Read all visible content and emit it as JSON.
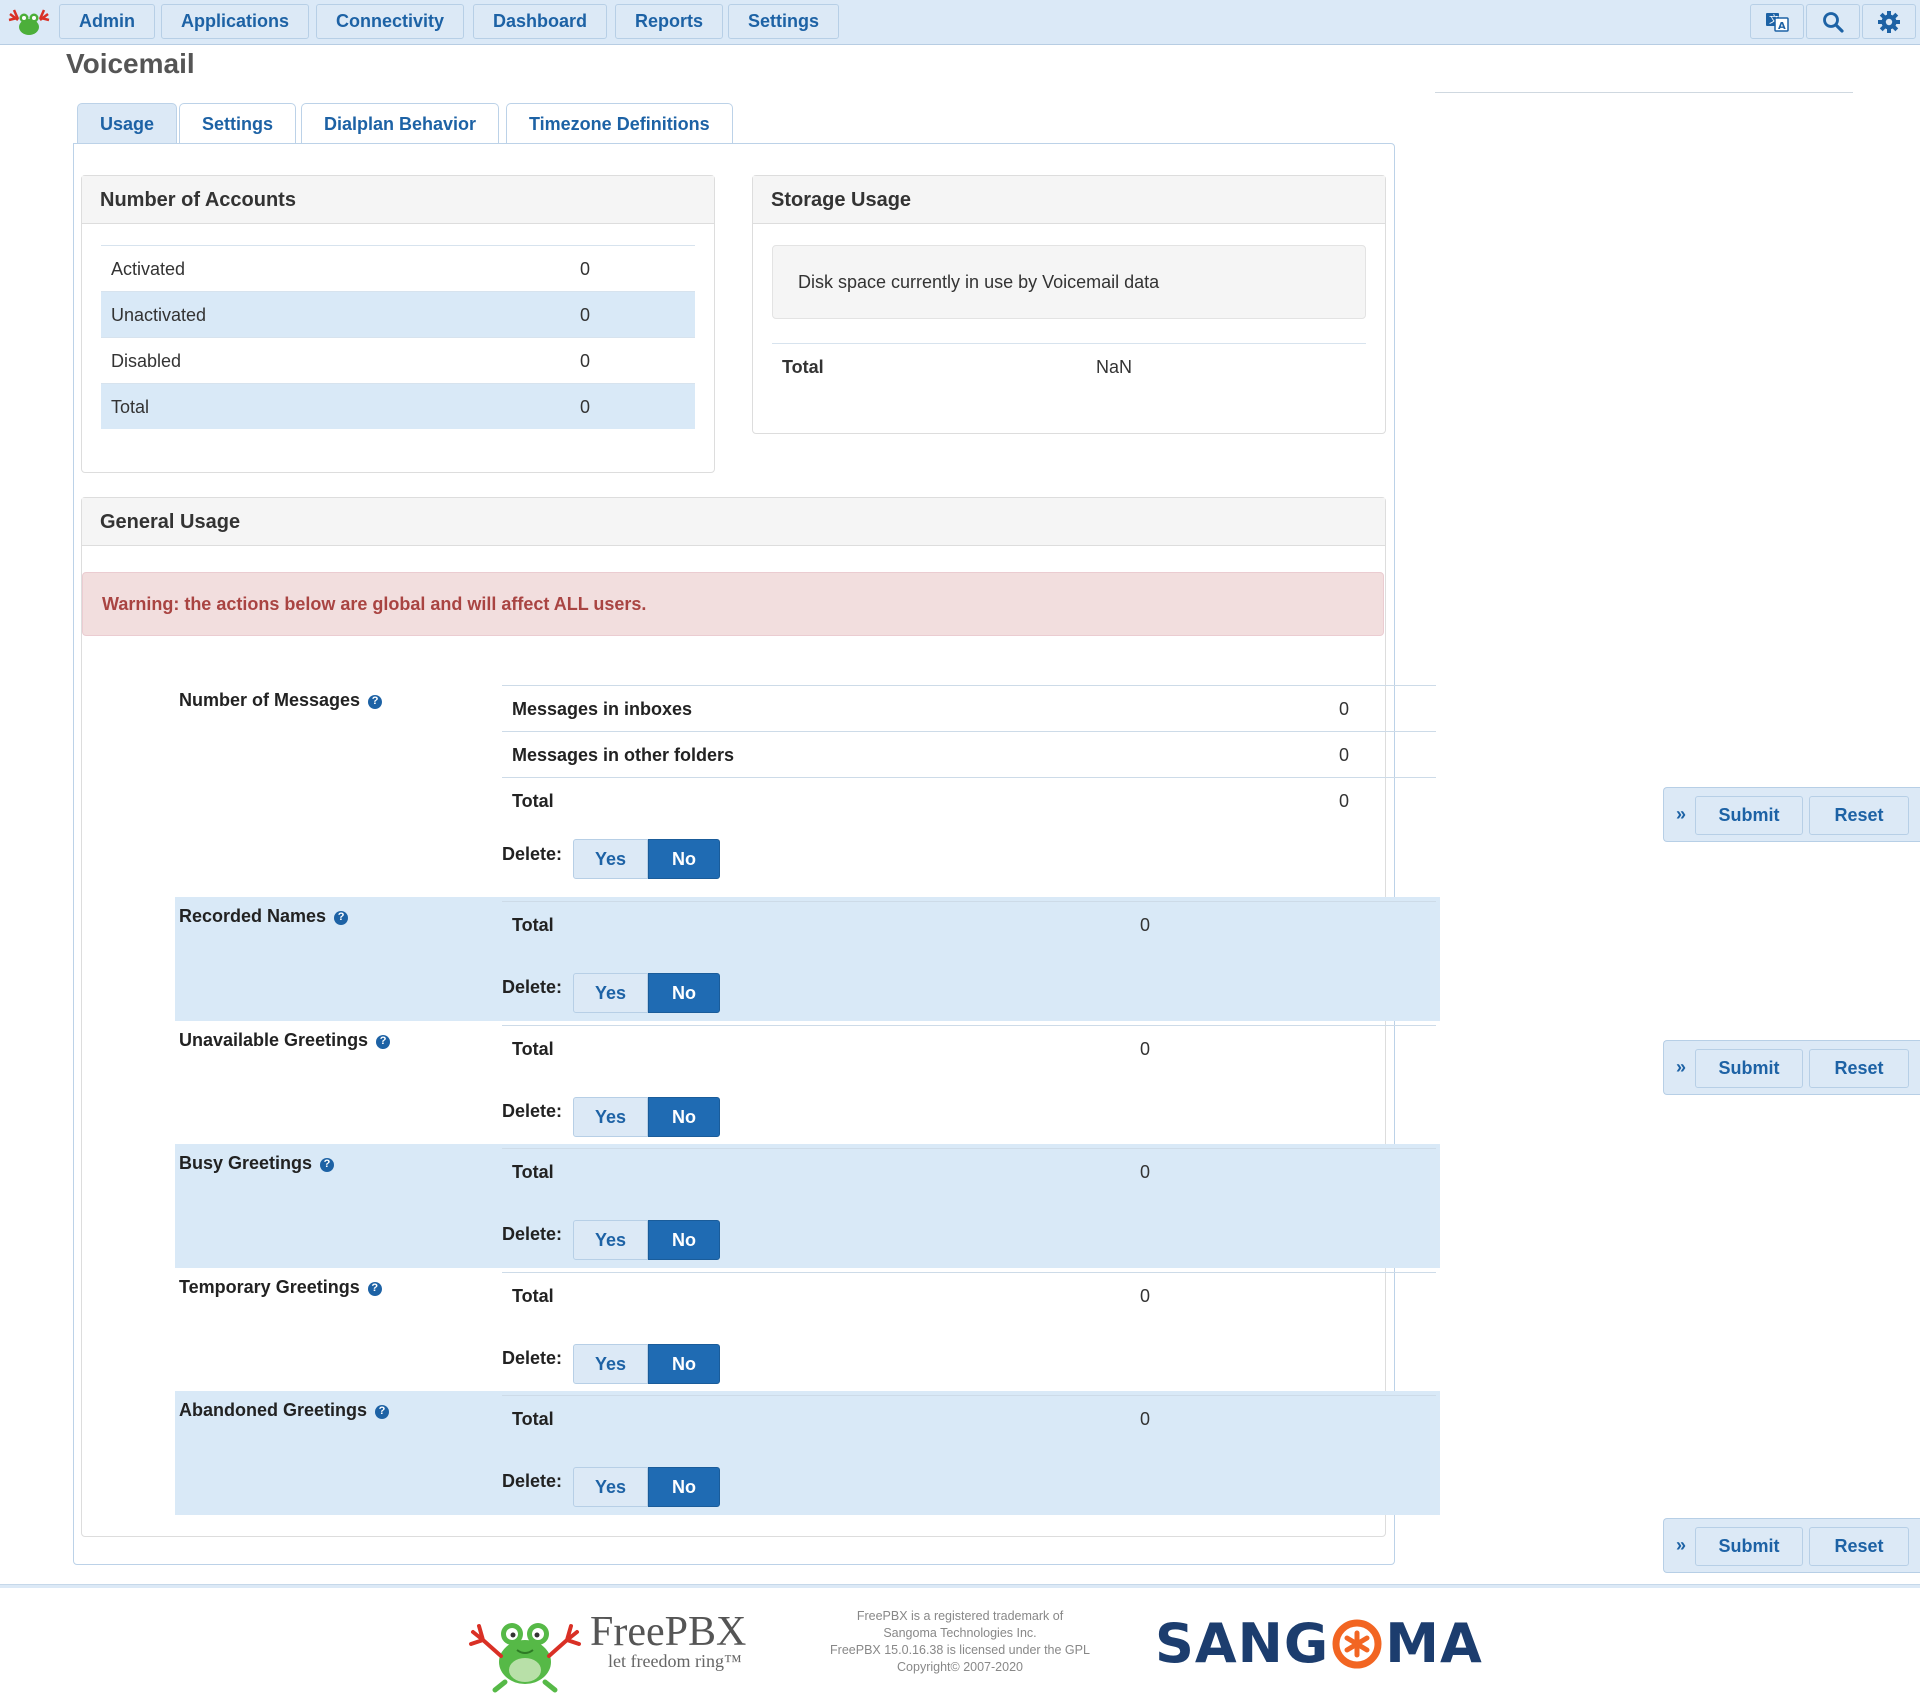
{
  "nav": {
    "items": [
      "Admin",
      "Applications",
      "Connectivity",
      "Dashboard",
      "Reports",
      "Settings"
    ],
    "icons": [
      "language-icon",
      "search-icon",
      "gear-icon"
    ]
  },
  "page": {
    "title": "Voicemail"
  },
  "tabs": [
    "Usage",
    "Settings",
    "Dialplan Behavior",
    "Timezone Definitions"
  ],
  "accounts": {
    "heading": "Number of Accounts",
    "rows": [
      {
        "label": "Activated",
        "value": "0"
      },
      {
        "label": "Unactivated",
        "value": "0"
      },
      {
        "label": "Disabled",
        "value": "0"
      },
      {
        "label": "Total",
        "value": "0"
      }
    ]
  },
  "storage": {
    "heading": "Storage Usage",
    "description": "Disk space currently in use by Voicemail data",
    "total_label": "Total",
    "total_value": "NaN"
  },
  "general": {
    "heading": "General Usage",
    "warning": "Warning: the actions below are global and will affect ALL users.",
    "delete_label": "Delete:",
    "yes_label": "Yes",
    "no_label": "No",
    "messages": {
      "label": "Number of Messages",
      "rows": [
        {
          "label": "Messages in inboxes",
          "value": "0"
        },
        {
          "label": "Messages in other folders",
          "value": "0"
        },
        {
          "label": "Total",
          "value": "0"
        }
      ]
    },
    "sections": [
      {
        "label": "Recorded Names",
        "total_label": "Total",
        "total": "0"
      },
      {
        "label": "Unavailable Greetings",
        "total_label": "Total",
        "total": "0"
      },
      {
        "label": "Busy Greetings",
        "total_label": "Total",
        "total": "0"
      },
      {
        "label": "Temporary Greetings",
        "total_label": "Total",
        "total": "0"
      },
      {
        "label": "Abandoned Greetings",
        "total_label": "Total",
        "total": "0"
      }
    ]
  },
  "actions": {
    "expand": "»",
    "submit": "Submit",
    "reset": "Reset"
  },
  "footer": {
    "brand": "FreePBX",
    "tagline": "let freedom ring™",
    "legal": [
      "FreePBX is a registered trademark of",
      "Sangoma Technologies Inc.",
      "FreePBX 15.0.16.38 is licensed under the GPL",
      "Copyright© 2007-2020"
    ],
    "company_left": "SANG",
    "company_right": "MA"
  },
  "colors": {
    "nav_bg": "#dbe9f7",
    "link": "#1d62a5",
    "active_toggle": "#1f6bb3",
    "stripe": "#d9e9f7",
    "warning_bg": "#f2dede",
    "warning_text": "#a94442",
    "sangoma_blue": "#1c3d6e",
    "sangoma_orange": "#f26522"
  }
}
